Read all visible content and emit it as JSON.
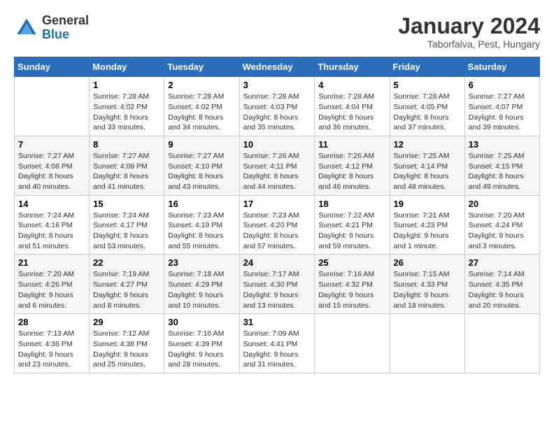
{
  "header": {
    "logo_general": "General",
    "logo_blue": "Blue",
    "title": "January 2024",
    "subtitle": "Taborfalva, Pest, Hungary"
  },
  "days_of_week": [
    "Sunday",
    "Monday",
    "Tuesday",
    "Wednesday",
    "Thursday",
    "Friday",
    "Saturday"
  ],
  "weeks": [
    [
      {
        "num": "",
        "detail": ""
      },
      {
        "num": "1",
        "detail": "Sunrise: 7:28 AM\nSunset: 4:02 PM\nDaylight: 8 hours\nand 33 minutes."
      },
      {
        "num": "2",
        "detail": "Sunrise: 7:28 AM\nSunset: 4:02 PM\nDaylight: 8 hours\nand 34 minutes."
      },
      {
        "num": "3",
        "detail": "Sunrise: 7:28 AM\nSunset: 4:03 PM\nDaylight: 8 hours\nand 35 minutes."
      },
      {
        "num": "4",
        "detail": "Sunrise: 7:28 AM\nSunset: 4:04 PM\nDaylight: 8 hours\nand 36 minutes."
      },
      {
        "num": "5",
        "detail": "Sunrise: 7:28 AM\nSunset: 4:05 PM\nDaylight: 8 hours\nand 37 minutes."
      },
      {
        "num": "6",
        "detail": "Sunrise: 7:27 AM\nSunset: 4:07 PM\nDaylight: 8 hours\nand 39 minutes."
      }
    ],
    [
      {
        "num": "7",
        "detail": "Sunrise: 7:27 AM\nSunset: 4:08 PM\nDaylight: 8 hours\nand 40 minutes."
      },
      {
        "num": "8",
        "detail": "Sunrise: 7:27 AM\nSunset: 4:09 PM\nDaylight: 8 hours\nand 41 minutes."
      },
      {
        "num": "9",
        "detail": "Sunrise: 7:27 AM\nSunset: 4:10 PM\nDaylight: 8 hours\nand 43 minutes."
      },
      {
        "num": "10",
        "detail": "Sunrise: 7:26 AM\nSunset: 4:11 PM\nDaylight: 8 hours\nand 44 minutes."
      },
      {
        "num": "11",
        "detail": "Sunrise: 7:26 AM\nSunset: 4:12 PM\nDaylight: 8 hours\nand 46 minutes."
      },
      {
        "num": "12",
        "detail": "Sunrise: 7:25 AM\nSunset: 4:14 PM\nDaylight: 8 hours\nand 48 minutes."
      },
      {
        "num": "13",
        "detail": "Sunrise: 7:25 AM\nSunset: 4:15 PM\nDaylight: 8 hours\nand 49 minutes."
      }
    ],
    [
      {
        "num": "14",
        "detail": "Sunrise: 7:24 AM\nSunset: 4:16 PM\nDaylight: 8 hours\nand 51 minutes."
      },
      {
        "num": "15",
        "detail": "Sunrise: 7:24 AM\nSunset: 4:17 PM\nDaylight: 8 hours\nand 53 minutes."
      },
      {
        "num": "16",
        "detail": "Sunrise: 7:23 AM\nSunset: 4:19 PM\nDaylight: 8 hours\nand 55 minutes."
      },
      {
        "num": "17",
        "detail": "Sunrise: 7:23 AM\nSunset: 4:20 PM\nDaylight: 8 hours\nand 57 minutes."
      },
      {
        "num": "18",
        "detail": "Sunrise: 7:22 AM\nSunset: 4:21 PM\nDaylight: 8 hours\nand 59 minutes."
      },
      {
        "num": "19",
        "detail": "Sunrise: 7:21 AM\nSunset: 4:23 PM\nDaylight: 9 hours\nand 1 minute."
      },
      {
        "num": "20",
        "detail": "Sunrise: 7:20 AM\nSunset: 4:24 PM\nDaylight: 9 hours\nand 3 minutes."
      }
    ],
    [
      {
        "num": "21",
        "detail": "Sunrise: 7:20 AM\nSunset: 4:26 PM\nDaylight: 9 hours\nand 6 minutes."
      },
      {
        "num": "22",
        "detail": "Sunrise: 7:19 AM\nSunset: 4:27 PM\nDaylight: 9 hours\nand 8 minutes."
      },
      {
        "num": "23",
        "detail": "Sunrise: 7:18 AM\nSunset: 4:29 PM\nDaylight: 9 hours\nand 10 minutes."
      },
      {
        "num": "24",
        "detail": "Sunrise: 7:17 AM\nSunset: 4:30 PM\nDaylight: 9 hours\nand 13 minutes."
      },
      {
        "num": "25",
        "detail": "Sunrise: 7:16 AM\nSunset: 4:32 PM\nDaylight: 9 hours\nand 15 minutes."
      },
      {
        "num": "26",
        "detail": "Sunrise: 7:15 AM\nSunset: 4:33 PM\nDaylight: 9 hours\nand 18 minutes."
      },
      {
        "num": "27",
        "detail": "Sunrise: 7:14 AM\nSunset: 4:35 PM\nDaylight: 9 hours\nand 20 minutes."
      }
    ],
    [
      {
        "num": "28",
        "detail": "Sunrise: 7:13 AM\nSunset: 4:36 PM\nDaylight: 9 hours\nand 23 minutes."
      },
      {
        "num": "29",
        "detail": "Sunrise: 7:12 AM\nSunset: 4:38 PM\nDaylight: 9 hours\nand 25 minutes."
      },
      {
        "num": "30",
        "detail": "Sunrise: 7:10 AM\nSunset: 4:39 PM\nDaylight: 9 hours\nand 28 minutes."
      },
      {
        "num": "31",
        "detail": "Sunrise: 7:09 AM\nSunset: 4:41 PM\nDaylight: 9 hours\nand 31 minutes."
      },
      {
        "num": "",
        "detail": ""
      },
      {
        "num": "",
        "detail": ""
      },
      {
        "num": "",
        "detail": ""
      }
    ]
  ]
}
